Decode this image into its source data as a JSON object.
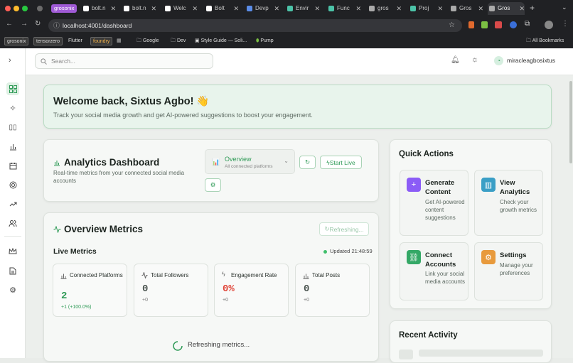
{
  "browser": {
    "group_label": "grosonix",
    "tabs": [
      "bolt.n",
      "bolt.n",
      "Welc",
      "Bolt",
      "Devp",
      "Envir",
      "Func",
      "gros",
      "Proj",
      "Gros",
      "Gros"
    ],
    "url": "localhost:4001/dashboard",
    "bookmarks": [
      "grosonix",
      "tensorzero",
      "Flutter",
      "foundry",
      "Google",
      "Dev",
      "Style Guide — Soli...",
      "Pump"
    ],
    "all_bookmarks": "All Bookmarks"
  },
  "header": {
    "search_placeholder": "Search...",
    "username": "miracleagbosixtus"
  },
  "welcome": {
    "title": "Welcome back, Sixtus Agbo! 👋",
    "subtitle": "Track your social media growth and get AI-powered suggestions to boost your engagement."
  },
  "analytics": {
    "title": "Analytics Dashboard",
    "description": "Real-time metrics from your connected social media accounts",
    "selector_title": "Overview",
    "selector_subtitle": "All connected platforms",
    "start_live": "Start Live"
  },
  "overview": {
    "title": "Overview Metrics",
    "refreshing_button": "Refreshing...",
    "live_label": "Live Metrics",
    "updated": "Updated 21:48:59",
    "metrics": [
      {
        "label": "Connected Platforms",
        "value": "2",
        "sub": "+1 (+100.0%)",
        "color": "#2e9a56",
        "sub_color": "#2e9a56"
      },
      {
        "label": "Total Followers",
        "value": "0",
        "sub": "+0",
        "color": "#4b5450",
        "sub_color": "#777777"
      },
      {
        "label": "Engagement Rate",
        "value": "0%",
        "sub": "+0",
        "color": "#e0463a",
        "sub_color": "#777777"
      },
      {
        "label": "Total Posts",
        "value": "0",
        "sub": "+0",
        "color": "#4b5450",
        "sub_color": "#777777"
      }
    ],
    "refreshing_text": "Refreshing metrics..."
  },
  "quick_actions": {
    "title": "Quick Actions",
    "items": [
      {
        "title": "Generate Content",
        "desc": "Get AI-powered content suggestions",
        "color": "#8b5cf6",
        "icon": "plus-icon"
      },
      {
        "title": "View Analytics",
        "desc": "Check your growth metrics",
        "color": "#3b9fc6",
        "icon": "bar-chart-icon"
      },
      {
        "title": "Connect Accounts",
        "desc": "Link your social media accounts",
        "color": "#34a866",
        "icon": "link-icon"
      },
      {
        "title": "Settings",
        "desc": "Manage your preferences",
        "color": "#e89a3c",
        "icon": "gear-icon"
      }
    ]
  },
  "recent_activity": {
    "title": "Recent Activity"
  }
}
